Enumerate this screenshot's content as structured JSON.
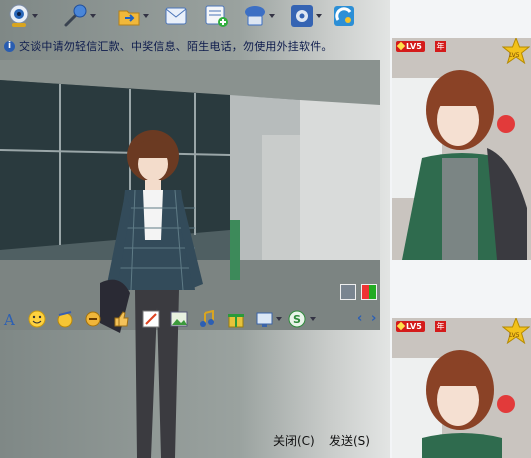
{
  "notice": {
    "icon": "info-icon",
    "text": "交谈中请勿轻信汇款、中奖信息、陌生电话，勿使用外挂软件。"
  },
  "toolbar": {
    "items": [
      {
        "icon": "webcam-icon"
      },
      {
        "icon": "microphone-icon"
      },
      {
        "icon": "send-file-icon"
      },
      {
        "icon": "send-message-icon"
      },
      {
        "icon": "create-group-icon"
      },
      {
        "icon": "remote-assist-icon"
      },
      {
        "icon": "settings-icon"
      },
      {
        "icon": "apps-icon"
      }
    ]
  },
  "format_bar": {
    "items": [
      {
        "icon": "font-icon"
      },
      {
        "icon": "emoticon-icon"
      },
      {
        "icon": "magic-emoticon-icon"
      },
      {
        "icon": "shake-icon"
      },
      {
        "icon": "thumbs-up-icon"
      },
      {
        "icon": "scribble-icon"
      },
      {
        "icon": "image-icon"
      },
      {
        "icon": "music-icon"
      },
      {
        "icon": "gift-icon"
      },
      {
        "icon": "screenshot-icon"
      },
      {
        "icon": "sogou-input-icon"
      }
    ]
  },
  "buttons": {
    "close_label": "关闭(C)",
    "send_label": "发送(S)"
  },
  "avatars": [
    {
      "level": "LV5",
      "year_badge": "年",
      "star_label": "LV5"
    },
    {
      "level": "LV5",
      "year_badge": "年",
      "star_label": "LV5"
    }
  ]
}
